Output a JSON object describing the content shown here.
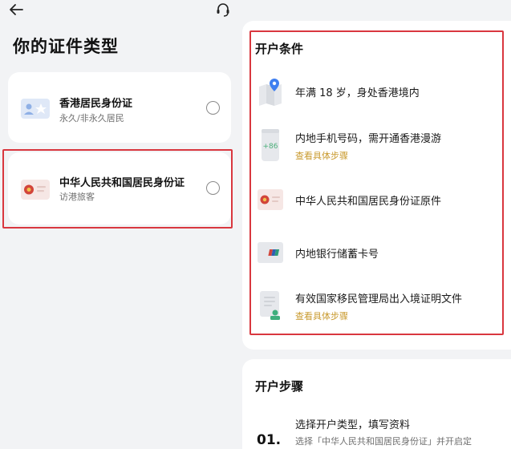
{
  "header": {
    "back_icon": "back-arrow-icon",
    "support_icon": "headset-icon"
  },
  "left": {
    "title": "你的证件类型",
    "options": [
      {
        "title": "香港居民身份证",
        "subtitle": "永久/非永久居民",
        "icon": "hk-id-card-icon",
        "selected": false
      },
      {
        "title": "中华人民共和国居民身份证",
        "subtitle": "访港旅客",
        "icon": "prc-id-card-icon",
        "selected": false
      }
    ]
  },
  "conditions": {
    "title": "开户条件",
    "items": [
      {
        "text": "年满 18 岁，身处香港境内",
        "link": "",
        "icon": "map-pin-icon"
      },
      {
        "text": "内地手机号码，需开通香港漫游",
        "link": "查看具体步骤",
        "icon": "phone-plus86-icon"
      },
      {
        "text": "中华人民共和国居民身份证原件",
        "link": "",
        "icon": "prc-id-card-icon"
      },
      {
        "text": "内地银行储蓄卡号",
        "link": "",
        "icon": "bank-card-icon"
      },
      {
        "text": "有效国家移民管理局出入境证明文件",
        "link": "查看具体步骤",
        "icon": "document-stamp-icon"
      }
    ]
  },
  "steps": {
    "title": "开户步骤",
    "items": [
      {
        "number": "01.",
        "title": "选择开户类型，填写资料",
        "desc": "选择「中华人民共和国居民身份证」并开启定"
      }
    ]
  },
  "colors": {
    "highlight": "#d9373f",
    "link": "#c99a2e",
    "background": "#f2f3f5",
    "card": "#ffffff"
  }
}
